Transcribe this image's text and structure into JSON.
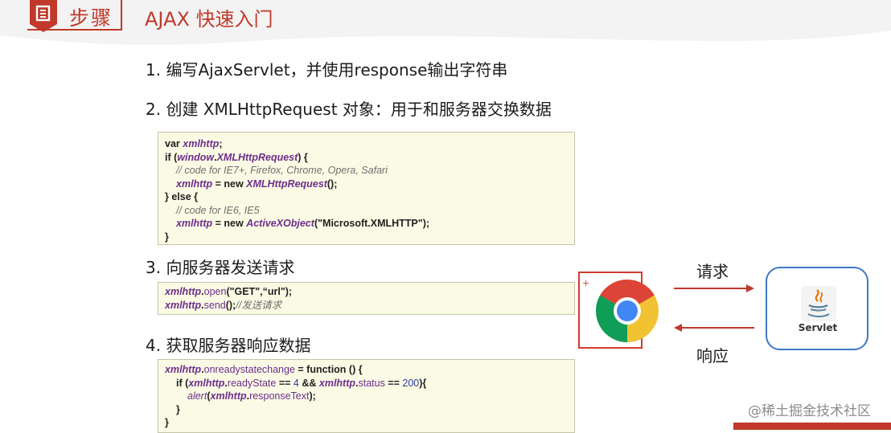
{
  "header": {
    "step_label": "步骤",
    "title": "AJAX 快速入门"
  },
  "steps": [
    "1. 编写AjaxServlet，并使用response输出字符串",
    "2. 创建 XMLHttpRequest 对象：用于和服务器交换数据",
    "3. 向服务器发送请求",
    "4. 获取服务器响应数据"
  ],
  "code": {
    "create": {
      "l1": [
        "var ",
        "xmlhttp",
        ";"
      ],
      "l2": [
        "if (",
        "window",
        ".",
        "XMLHttpRequest",
        ") {"
      ],
      "l3": "// code for IE7+, Firefox, Chrome, Opera, Safari",
      "l4": [
        "xmlhttp",
        " = new ",
        "XMLHttpRequest",
        "();"
      ],
      "l5": "} else {",
      "l6": "// code for IE6, IE5",
      "l7": [
        "xmlhttp",
        " = new ",
        "ActiveXObject",
        "(\"Microsoft.XMLHTTP\");"
      ],
      "l8": "}"
    },
    "send": {
      "l1": [
        "xmlhttp",
        ".",
        "open",
        "(\"GET\",“url\");"
      ],
      "l2": [
        "xmlhttp",
        ".",
        "send",
        "();",
        "//发送请求"
      ]
    },
    "response": {
      "l1": [
        "xmlhttp",
        ".",
        "onreadystatechange",
        " = function () {"
      ],
      "l2": [
        "if (",
        "xmlhttp",
        ".",
        "readyState",
        " == ",
        "4",
        " && ",
        "xmlhttp",
        ".",
        "status",
        " == ",
        "200",
        "){"
      ],
      "l3": [
        "alert",
        "(",
        "xmlhttp",
        ".",
        "responseText",
        ");"
      ],
      "l4": "}",
      "l5": "}"
    }
  },
  "diagram": {
    "request_label": "请求",
    "response_label": "响应",
    "plus_mark": "+",
    "server_label": "Servlet"
  },
  "watermark": "@稀土掘金技术社区",
  "colors": {
    "accent": "#c0392b",
    "code_bg": "#fbfbe5",
    "identifier": "#6c2d8c",
    "server_border": "#3d77c8"
  }
}
